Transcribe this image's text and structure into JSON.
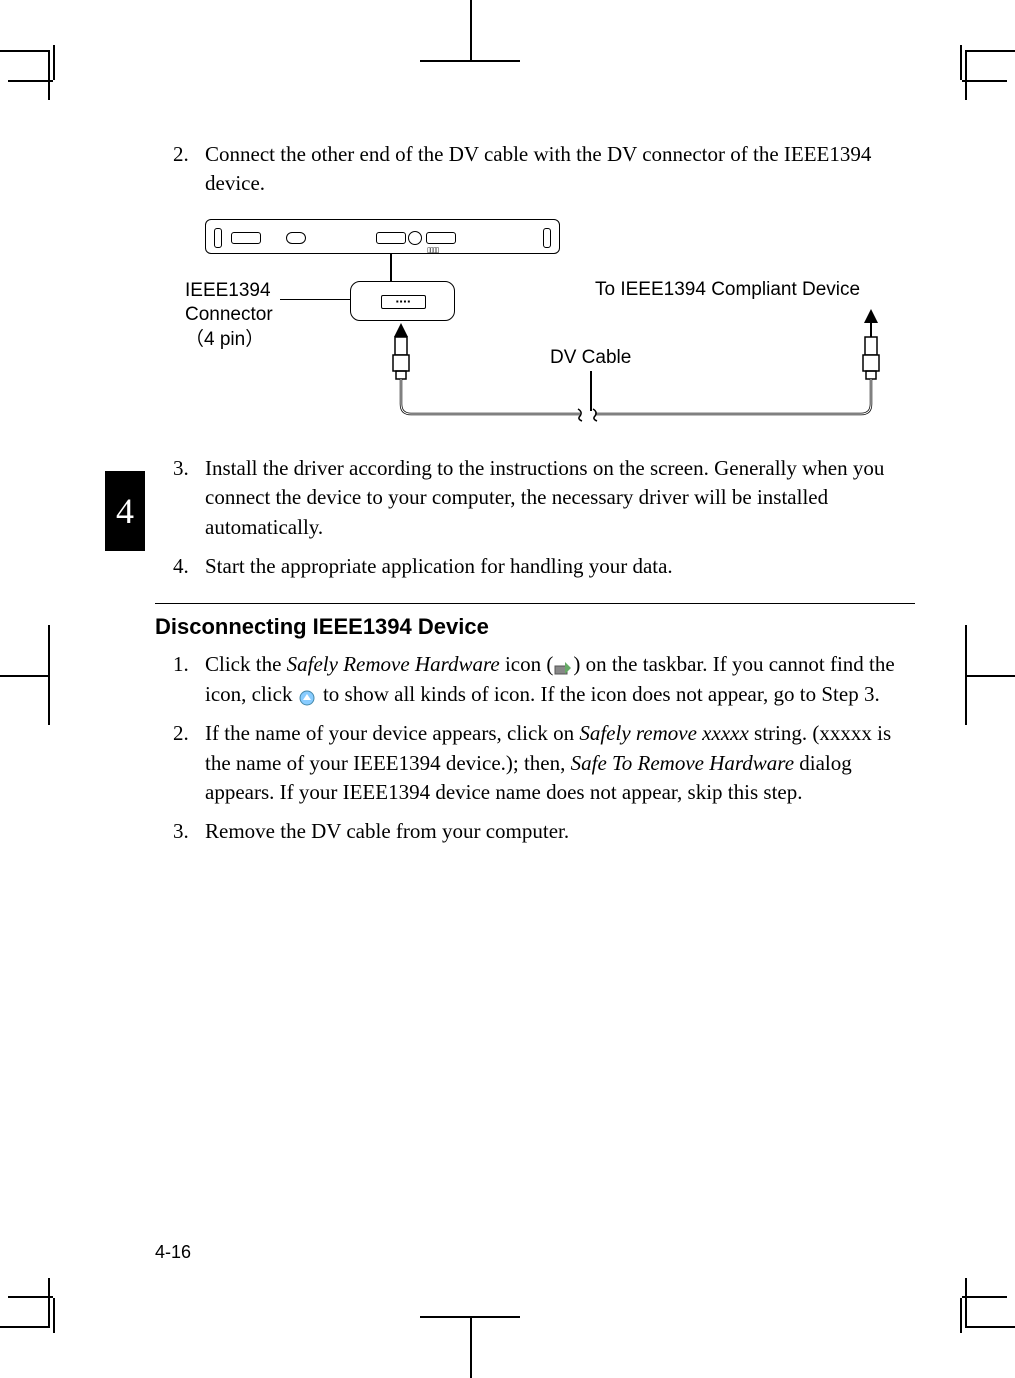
{
  "chapter_number": "4",
  "page_number": "4-16",
  "step2": {
    "num": "2.",
    "text": "Connect the other end of the DV cable with the DV connector of the IEEE1394 device."
  },
  "diagram": {
    "ieee_label_line1": "IEEE1394",
    "ieee_label_line2": "Connector",
    "ieee_label_line3": "（4 pin）",
    "compliant_label": "To IEEE1394 Compliant Device",
    "dv_cable_label": "DV Cable"
  },
  "step3": {
    "num": "3.",
    "text": "Install the driver according to the instructions on the screen. Generally when you connect the device to your computer, the necessary driver will be installed automatically."
  },
  "step4": {
    "num": "4.",
    "text": "Start the appropriate application for handling your data."
  },
  "section_heading": "Disconnecting IEEE1394 Device",
  "disc_step1": {
    "num": "1.",
    "text_a": "Click the ",
    "text_b": "Safely Remove Hardware",
    "text_c": " icon (",
    "text_d": ") on the taskbar. If you cannot find the icon, click ",
    "text_e": " to show all kinds of icon. If the icon does not appear, go to Step 3."
  },
  "disc_step2": {
    "num": "2.",
    "text_a": "If the name of your device appears, click on ",
    "text_b": "Safely remove xxxxx",
    "text_c": " string. (xxxxx is the name of your IEEE1394 device.); then, ",
    "text_d": "Safe To Remove Hardware",
    "text_e": " dialog appears. If your IEEE1394 device name does not appear, skip this step."
  },
  "disc_step3": {
    "num": "3.",
    "text": "Remove the DV cable from your computer."
  }
}
